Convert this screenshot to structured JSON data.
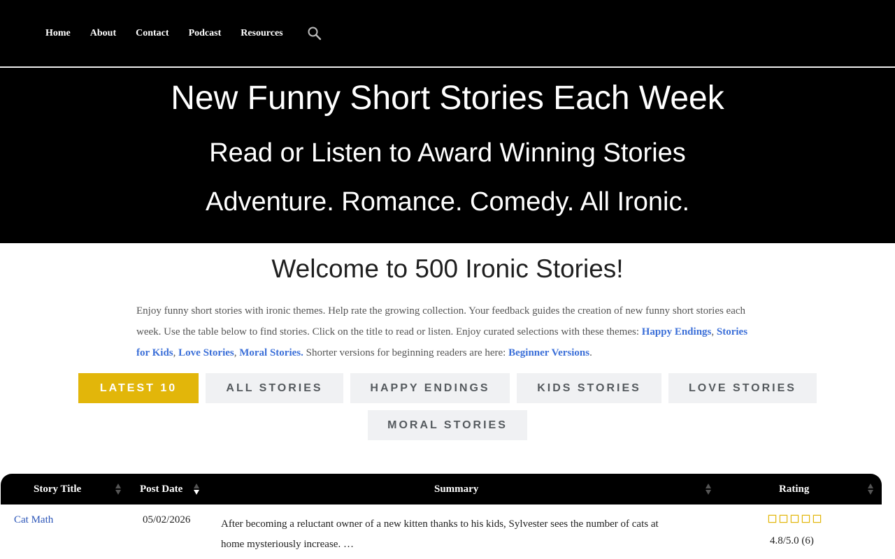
{
  "nav": {
    "items": [
      "Home",
      "About",
      "Contact",
      "Podcast",
      "Resources"
    ],
    "search_icon": "search-icon"
  },
  "hero": {
    "line1": "New Funny Short Stories Each Week",
    "line2": "Read or Listen to Award Winning Stories",
    "line3": "Adventure. Romance. Comedy. All Ironic."
  },
  "welcome": {
    "title": "Welcome to 500 Ironic Stories!",
    "intro_text": "Enjoy funny short stories with ironic themes. Help rate the growing collection. Your feedback guides the creation of new funny short stories each week. Use the table below to find stories. Click on the title to read or listen. Enjoy curated selections with these themes:",
    "link_happy": "Happy Endings",
    "link_kids": "Stories for Kids",
    "link_love": "Love Stories",
    "link_moral": "Moral Stories.",
    "shorter_text": "Shorter versions for beginning readers are here:",
    "link_beginner": "Beginner Versions"
  },
  "filters": {
    "latest": "LATEST 10",
    "all": "ALL STORIES",
    "happy": "HAPPY ENDINGS",
    "kids": "KIDS STORIES",
    "love": "LOVE STORIES",
    "moral": "MORAL STORIES",
    "active": "LATEST 10"
  },
  "table": {
    "headers": {
      "title": "Story Title",
      "date": "Post Date",
      "summary": "Summary",
      "rating": "Rating"
    },
    "rows": [
      {
        "title": "Cat Math",
        "date": "05/02/2026",
        "summary_line1": "After becoming a reluctant owner of a new kitten thanks to his kids, Sylvester sees the number of cats at",
        "summary_line2": "home mysteriously increase. …",
        "stars": 5,
        "rating": "4.8/5.0 (6)"
      }
    ]
  },
  "colors": {
    "accent": "#e2b60a",
    "link": "#3b6fd8",
    "header_bg": "#000000",
    "button_bg": "#f0f1f3"
  }
}
